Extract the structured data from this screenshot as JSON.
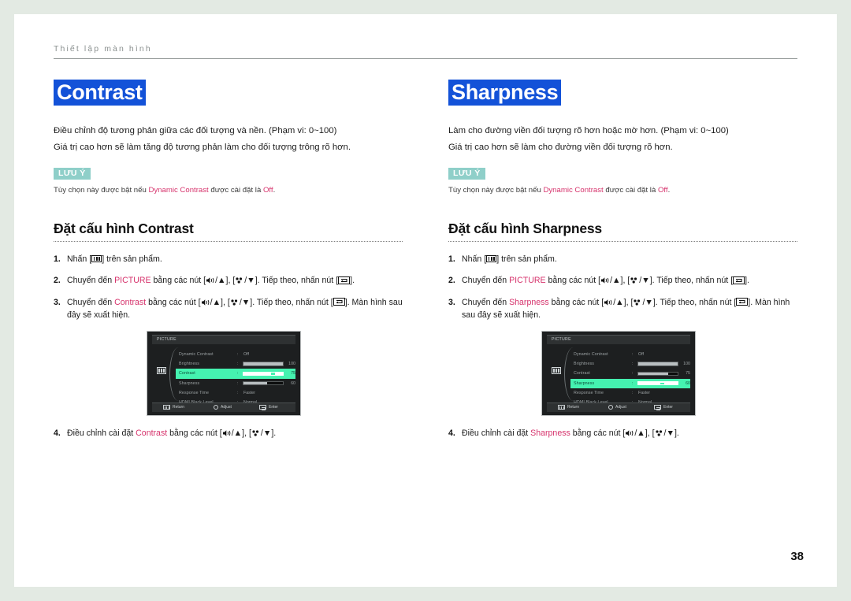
{
  "breadcrumb": "Thiết lập màn hình",
  "page_number": "38",
  "colors": {
    "title_highlight": "#1352d8",
    "note_badge": "#8fcfc9",
    "keyword": "#d6336c",
    "osd_highlight": "#45f2b0",
    "page_background": "#e3eae3"
  },
  "columns": [
    {
      "title": "Contrast",
      "desc_line1": "Điều chỉnh độ tương phản giữa các đối tượng và nền. (Phạm vi: 0~100)",
      "desc_line2": "Giá trị cao hơn sẽ làm tăng độ tương phản làm cho đối tượng trông rõ hơn.",
      "note_badge": "LƯU Ý",
      "note_pre": "Tùy chọn này được bật nếu ",
      "note_kw1": "Dynamic Contrast",
      "note_mid": " được cài đặt là ",
      "note_kw2": "Off",
      "note_post": ".",
      "section_title": "Đặt cấu hình Contrast",
      "steps": {
        "n1": "1.",
        "s1_a": "Nhấn [",
        "s1_b": "] trên sản phẩm.",
        "n2": "2.",
        "s2_a": "Chuyển đến ",
        "s2_kw": "PICTURE",
        "s2_b": " bằng các nút [",
        "s2_c": "/▲], [",
        "s2_d": "/▼]. Tiếp theo, nhấn nút [",
        "s2_e": "].",
        "n3": "3.",
        "s3_a": "Chuyển đến ",
        "s3_kw": "Contrast",
        "s3_b": " bằng các nút [",
        "s3_c": "/▲], [",
        "s3_d": "/▼]. Tiếp theo, nhấn nút [",
        "s3_e": "]. Màn hình sau đây sẽ xuất hiện.",
        "n4": "4.",
        "s4_a": "Điều chỉnh cài đặt ",
        "s4_kw": "Contrast",
        "s4_b": " bằng các nút [",
        "s4_c": "/▲], [",
        "s4_d": "/▼]."
      },
      "osd": {
        "title": "PICTURE",
        "rows": [
          {
            "label": "Dynamic Contrast",
            "type": "text",
            "value": "Off"
          },
          {
            "label": "Brightness",
            "type": "bar",
            "value": "100",
            "percent": 100
          },
          {
            "label": "Contrast",
            "type": "bar",
            "value": "75",
            "percent": 75,
            "active": true
          },
          {
            "label": "Sharpness",
            "type": "bar",
            "value": "60",
            "percent": 60
          },
          {
            "label": "Response Time",
            "type": "text",
            "value": "Faster"
          },
          {
            "label": "HDMI Black Level",
            "type": "text",
            "value": "Normal"
          }
        ],
        "footer": {
          "return": "Return",
          "adjust": "Adjust",
          "enter": "Enter"
        }
      }
    },
    {
      "title": "Sharpness",
      "desc_line1": "Làm cho đường viền đối tượng rõ hơn hoặc mờ hơn. (Phạm vi: 0~100)",
      "desc_line2": "Giá trị cao hơn sẽ làm cho đường viền đối tượng rõ hơn.",
      "note_badge": "LƯU Ý",
      "note_pre": "Tùy chọn này được bật nếu ",
      "note_kw1": "Dynamic Contrast",
      "note_mid": " được cài đặt là ",
      "note_kw2": "Off",
      "note_post": ".",
      "section_title": "Đặt cấu hình Sharpness",
      "steps": {
        "n1": "1.",
        "s1_a": "Nhấn [",
        "s1_b": "] trên sản phẩm.",
        "n2": "2.",
        "s2_a": "Chuyển đến ",
        "s2_kw": "PICTURE",
        "s2_b": " bằng các nút [",
        "s2_c": "/▲], [",
        "s2_d": "/▼]. Tiếp theo, nhấn nút [",
        "s2_e": "].",
        "n3": "3.",
        "s3_a": "Chuyển đến ",
        "s3_kw": "Sharpness",
        "s3_b": " bằng các nút [",
        "s3_c": "/▲], [",
        "s3_d": "/▼]. Tiếp theo, nhấn nút [",
        "s3_e": "]. Màn hình sau đây sẽ xuất hiện.",
        "n4": "4.",
        "s4_a": "Điều chỉnh cài đặt ",
        "s4_kw": "Sharpness",
        "s4_b": " bằng các nút [",
        "s4_c": "/▲], [",
        "s4_d": "/▼]."
      },
      "osd": {
        "title": "PICTURE",
        "rows": [
          {
            "label": "Dynamic Contrast",
            "type": "text",
            "value": "Off"
          },
          {
            "label": "Brightness",
            "type": "bar",
            "value": "100",
            "percent": 100
          },
          {
            "label": "Contrast",
            "type": "bar",
            "value": "75",
            "percent": 75
          },
          {
            "label": "Sharpness",
            "type": "bar",
            "value": "60",
            "percent": 60,
            "active": true
          },
          {
            "label": "Response Time",
            "type": "text",
            "value": "Faster"
          },
          {
            "label": "HDMI Black Level",
            "type": "text",
            "value": "Normal"
          }
        ],
        "footer": {
          "return": "Return",
          "adjust": "Adjust",
          "enter": "Enter"
        }
      }
    }
  ]
}
